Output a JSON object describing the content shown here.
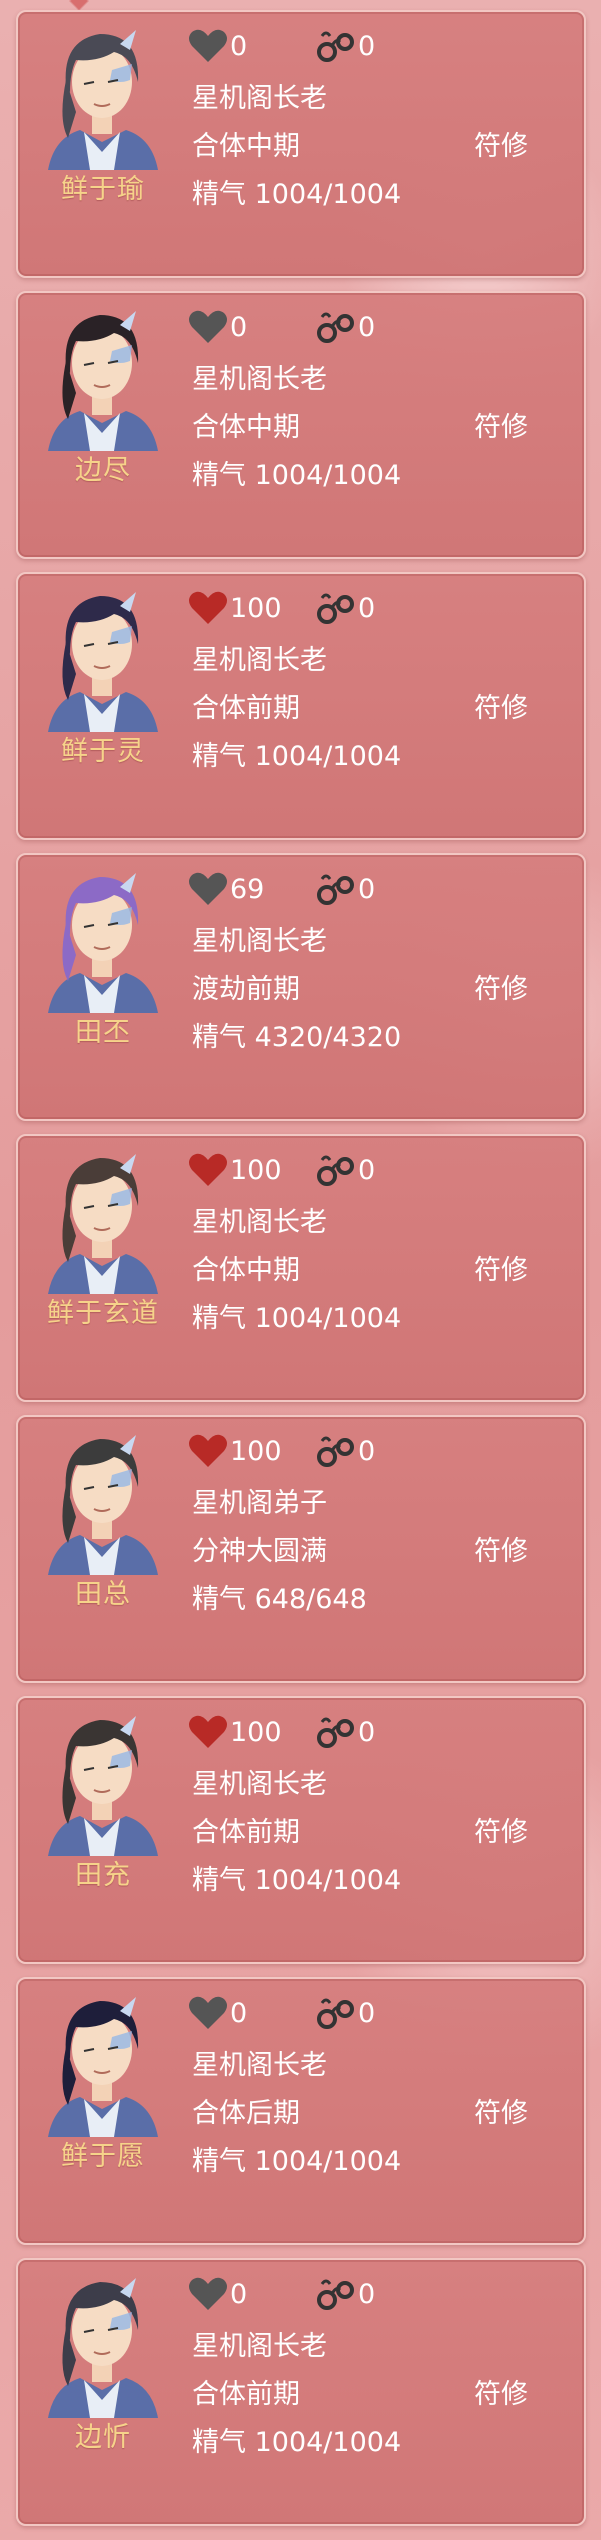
{
  "colors": {
    "favor_active": "#b82a26",
    "favor_inactive": "#555555",
    "name_color": "#f6d38a",
    "text_color": "#ffffff"
  },
  "cards": [
    {
      "name": "鲜于瑜",
      "favor": "0",
      "favor_active": false,
      "chain": "0",
      "title": "星机阁长老",
      "realm": "合体中期",
      "energy_label": "精气",
      "energy": "1004/1004",
      "job": "符修",
      "hair": "#4a4a55"
    },
    {
      "name": "边尽",
      "favor": "0",
      "favor_active": false,
      "chain": "0",
      "title": "星机阁长老",
      "realm": "合体中期",
      "energy_label": "精气",
      "energy": "1004/1004",
      "job": "符修",
      "hair": "#2a2226"
    },
    {
      "name": "鲜于灵",
      "favor": "100",
      "favor_active": true,
      "chain": "0",
      "title": "星机阁长老",
      "realm": "合体前期",
      "energy_label": "精气",
      "energy": "1004/1004",
      "job": "符修",
      "hair": "#2e2a4a"
    },
    {
      "name": "田丕",
      "favor": "69",
      "favor_active": false,
      "chain": "0",
      "title": "星机阁长老",
      "realm": "渡劫前期",
      "energy_label": "精气",
      "energy": "4320/4320",
      "job": "符修",
      "hair": "#8c6ac6"
    },
    {
      "name": "鲜于玄道",
      "favor": "100",
      "favor_active": true,
      "chain": "0",
      "title": "星机阁长老",
      "realm": "合体中期",
      "energy_label": "精气",
      "energy": "1004/1004",
      "job": "符修",
      "hair": "#4a3d38"
    },
    {
      "name": "田总",
      "favor": "100",
      "favor_active": true,
      "chain": "0",
      "title": "星机阁弟子",
      "realm": "分神大圆满",
      "energy_label": "精气",
      "energy": "648/648",
      "job": "符修",
      "hair": "#3c3c3c"
    },
    {
      "name": "田充",
      "favor": "100",
      "favor_active": true,
      "chain": "0",
      "title": "星机阁长老",
      "realm": "合体前期",
      "energy_label": "精气",
      "energy": "1004/1004",
      "job": "符修",
      "hair": "#3a3533"
    },
    {
      "name": "鲜于愿",
      "favor": "0",
      "favor_active": false,
      "chain": "0",
      "title": "星机阁长老",
      "realm": "合体后期",
      "energy_label": "精气",
      "energy": "1004/1004",
      "job": "符修",
      "hair": "#1e1e3a"
    },
    {
      "name": "边忻",
      "favor": "0",
      "favor_active": false,
      "chain": "0",
      "title": "星机阁长老",
      "realm": "合体前期",
      "energy_label": "精气",
      "energy": "1004/1004",
      "job": "符修",
      "hair": "#3d3d4a"
    }
  ]
}
